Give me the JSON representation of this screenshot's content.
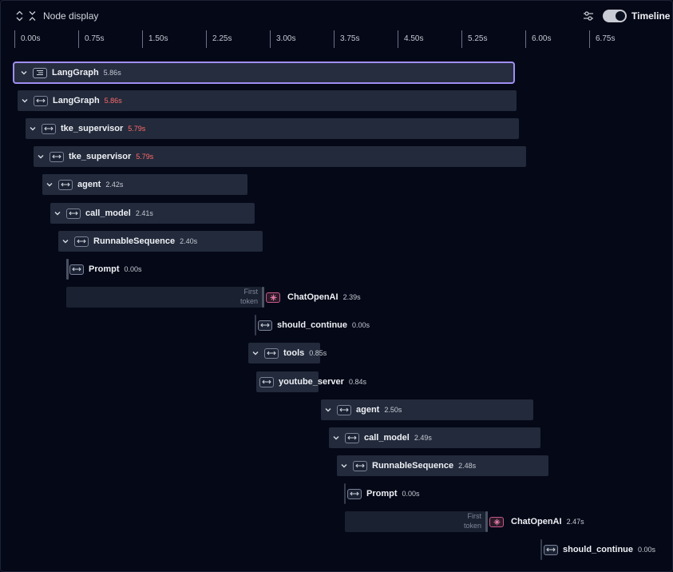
{
  "toolbar": {
    "node_display_label": "Node display",
    "timeline_label": "Timeline"
  },
  "ruler": {
    "ticks": [
      "0.00s",
      "0.75s",
      "1.50s",
      "2.25s",
      "3.00s",
      "3.75s",
      "4.50s",
      "5.25s",
      "6.00s",
      "6.75s"
    ]
  },
  "first_token": {
    "line1": "First",
    "line2": "token"
  },
  "rows": [
    {
      "name": "LangGraph",
      "duration": "5.86s"
    },
    {
      "name": "LangGraph",
      "duration": "5.86s"
    },
    {
      "name": "tke_supervisor",
      "duration": "5.79s"
    },
    {
      "name": "tke_supervisor",
      "duration": "5.79s"
    },
    {
      "name": "agent",
      "duration": "2.42s"
    },
    {
      "name": "call_model",
      "duration": "2.41s"
    },
    {
      "name": "RunnableSequence",
      "duration": "2.40s"
    },
    {
      "name": "Prompt",
      "duration": "0.00s"
    },
    {
      "name": "ChatOpenAI",
      "duration": "2.39s"
    },
    {
      "name": "should_continue",
      "duration": "0.00s"
    },
    {
      "name": "tools",
      "duration": "0.85s"
    },
    {
      "name": "youtube_server",
      "duration": "0.84s"
    },
    {
      "name": "agent",
      "duration": "2.50s"
    },
    {
      "name": "call_model",
      "duration": "2.49s"
    },
    {
      "name": "RunnableSequence",
      "duration": "2.48s"
    },
    {
      "name": "Prompt",
      "duration": "0.00s"
    },
    {
      "name": "ChatOpenAI",
      "duration": "2.47s"
    },
    {
      "name": "should_continue",
      "duration": "0.00s"
    }
  ],
  "colors": {
    "background": "#050817",
    "bar": "#222a3b",
    "selected_border": "#9f8ef2",
    "duration_warning": "#ff6b6b",
    "llm_icon": "#c7588a"
  }
}
